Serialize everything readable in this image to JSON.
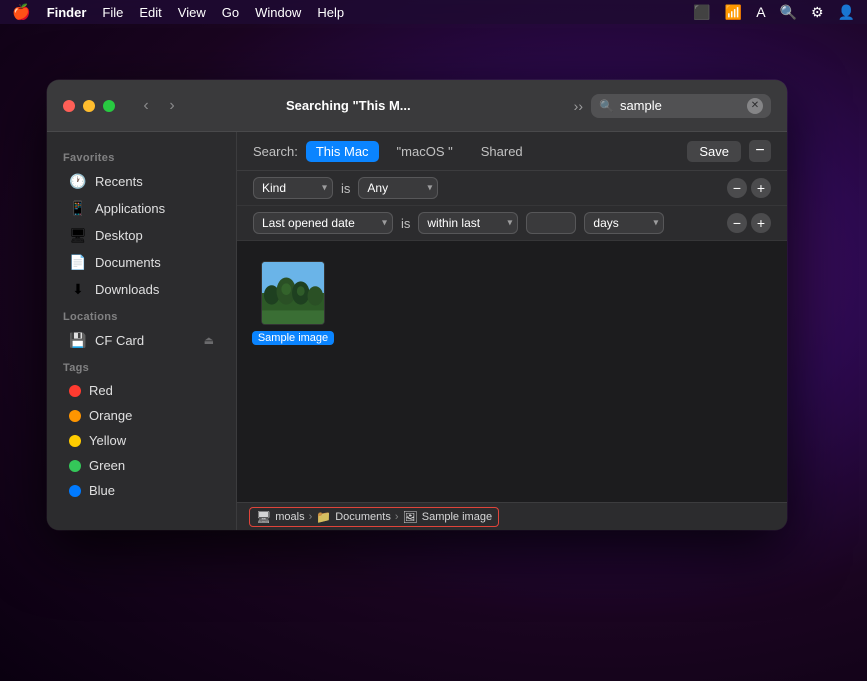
{
  "menubar": {
    "apple": "🍎",
    "items": [
      "Finder",
      "File",
      "Edit",
      "View",
      "Go",
      "Window",
      "Help"
    ],
    "finder_label": "Finder"
  },
  "window": {
    "title": "Searching \"This M...",
    "search_placeholder": "sample",
    "search_value": "sample"
  },
  "search_bar": {
    "search_label": "Search:",
    "scope_this_mac": "This Mac",
    "scope_macos": "\"macOS \"",
    "scope_shared": "Shared",
    "save_label": "Save",
    "minus_label": "−"
  },
  "filter1": {
    "field_label": "Kind",
    "operator_label": "is",
    "value_label": "Any",
    "minus_label": "−",
    "plus_label": "+"
  },
  "filter2": {
    "field_label": "Last opened date",
    "operator_label": "is",
    "value_label": "within last",
    "number_value": "",
    "unit_label": "days",
    "minus_label": "−",
    "plus_label": "+"
  },
  "file": {
    "name": "Sample image",
    "type": "image"
  },
  "breadcrumb": {
    "segment1_icon": "🖥",
    "segment1_label": "moals",
    "segment2_icon": "📁",
    "segment2_label": "Documents",
    "segment3_icon": "🖼",
    "segment3_label": "Sample image"
  },
  "sidebar": {
    "favorites_label": "Favorites",
    "locations_label": "Locations",
    "tags_label": "Tags",
    "items_favorites": [
      {
        "id": "recents",
        "icon": "🕐",
        "label": "Recents"
      },
      {
        "id": "applications",
        "icon": "📱",
        "label": "Applications"
      },
      {
        "id": "desktop",
        "icon": "🖥",
        "label": "Desktop"
      },
      {
        "id": "documents",
        "icon": "📄",
        "label": "Documents"
      },
      {
        "id": "downloads",
        "icon": "⬇",
        "label": "Downloads"
      }
    ],
    "items_locations": [
      {
        "id": "cf-card",
        "icon": "💾",
        "label": "CF Card",
        "eject": true
      }
    ],
    "tags": [
      {
        "id": "red",
        "color": "#ff3b30",
        "label": "Red"
      },
      {
        "id": "orange",
        "color": "#ff9500",
        "label": "Orange"
      },
      {
        "id": "yellow",
        "color": "#ffcc00",
        "label": "Yellow"
      },
      {
        "id": "green",
        "color": "#34c759",
        "label": "Green"
      },
      {
        "id": "blue",
        "color": "#007aff",
        "label": "Blue"
      }
    ]
  }
}
